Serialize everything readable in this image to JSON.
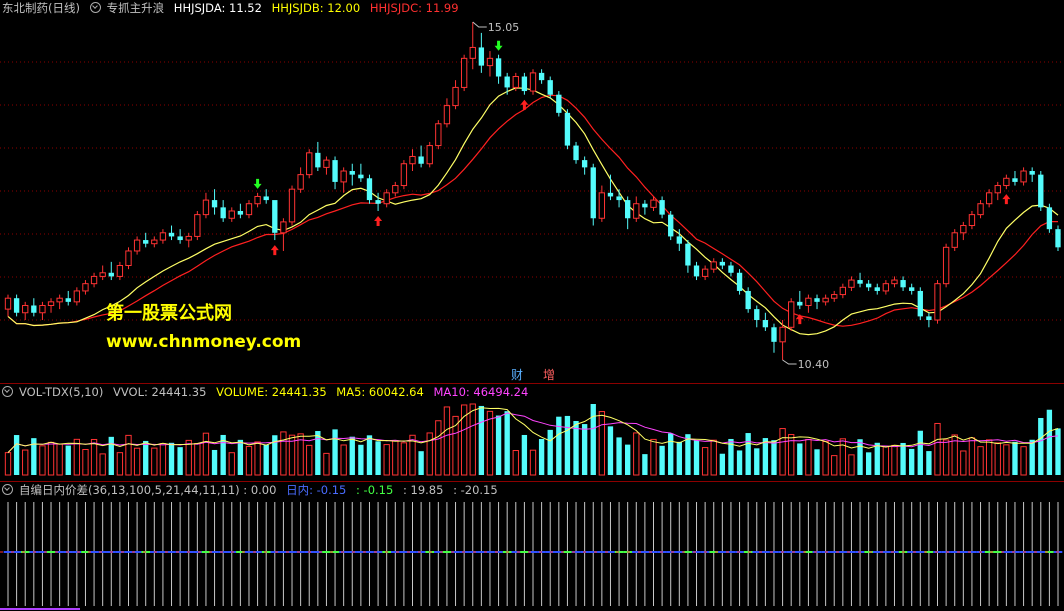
{
  "main_header": {
    "stock": "东北制药(日线)",
    "indicator": "专抓主升浪",
    "a_label": "HHJSJDA: 11.52",
    "b_label": "HHJSJDB: 12.00",
    "c_label": "HHJSJDC: 11.99"
  },
  "price_high_label": "15.05",
  "price_low_label": "10.40",
  "watermark": {
    "line1": "第一股票公式网",
    "line2": "www.chnmoney.com"
  },
  "badges": {
    "cai": "财",
    "zeng": "增"
  },
  "vol_header": {
    "name": "VOL-TDX(5,10)",
    "vvol": "VVOL: 24441.35",
    "volume": "VOLUME: 24441.35",
    "ma5": "MA5: 60042.64",
    "ma10": "MA10: 46494.24"
  },
  "ind_header": {
    "name": "自编日内价差(36,13,100,5,21,44,11,11) : 0.00",
    "rinei": "日内: -0.15",
    "v2": ": -0.15",
    "v3": ": 19.85",
    "v4": ": -20.15"
  },
  "colors": {
    "up": "#ff3333",
    "down": "#54fcfc",
    "ma_fast": "#ffff66",
    "ma_slow": "#ff2020",
    "vol_ma5": "#ffff66",
    "vol_ma10": "#ff44ff",
    "grid": "#8b0000"
  },
  "icons": {
    "up_arrow": "red-up-arrow-icon",
    "down_arrow": "green-down-arrow-icon"
  },
  "chart_data": {
    "type": "candlestick",
    "price_ticks": {
      "high": 15.05,
      "low": 10.4
    },
    "candles": [
      [
        11.1,
        11.3,
        11.0,
        11.25
      ],
      [
        11.25,
        11.3,
        11.0,
        11.05
      ],
      [
        11.05,
        11.2,
        10.95,
        11.15
      ],
      [
        11.15,
        11.25,
        11.0,
        11.05
      ],
      [
        11.05,
        11.2,
        10.95,
        11.15
      ],
      [
        11.15,
        11.25,
        11.05,
        11.2
      ],
      [
        11.2,
        11.3,
        11.1,
        11.25
      ],
      [
        11.25,
        11.35,
        11.15,
        11.2
      ],
      [
        11.2,
        11.4,
        11.15,
        11.35
      ],
      [
        11.35,
        11.5,
        11.3,
        11.45
      ],
      [
        11.45,
        11.6,
        11.4,
        11.55
      ],
      [
        11.55,
        11.7,
        11.5,
        11.6
      ],
      [
        11.6,
        11.75,
        11.5,
        11.55
      ],
      [
        11.55,
        11.75,
        11.5,
        11.7
      ],
      [
        11.7,
        11.95,
        11.65,
        11.9
      ],
      [
        11.9,
        12.1,
        11.85,
        12.05
      ],
      [
        12.05,
        12.15,
        11.95,
        12.0
      ],
      [
        12.0,
        12.1,
        11.95,
        12.05
      ],
      [
        12.05,
        12.2,
        12.0,
        12.15
      ],
      [
        12.15,
        12.25,
        12.05,
        12.1
      ],
      [
        12.1,
        12.2,
        12.0,
        12.05
      ],
      [
        12.05,
        12.15,
        11.95,
        12.1
      ],
      [
        12.1,
        12.45,
        12.05,
        12.4
      ],
      [
        12.4,
        12.7,
        12.35,
        12.6
      ],
      [
        12.6,
        12.75,
        12.4,
        12.5
      ],
      [
        12.5,
        12.6,
        12.3,
        12.35
      ],
      [
        12.35,
        12.5,
        12.3,
        12.45
      ],
      [
        12.45,
        12.55,
        12.35,
        12.4
      ],
      [
        12.4,
        12.6,
        12.35,
        12.55
      ],
      [
        12.55,
        12.7,
        12.5,
        12.65
      ],
      [
        12.65,
        12.75,
        12.55,
        12.6
      ],
      [
        12.6,
        12.5,
        12.05,
        12.15
      ],
      [
        12.15,
        12.35,
        11.9,
        12.3
      ],
      [
        12.3,
        12.8,
        12.25,
        12.75
      ],
      [
        12.75,
        13.05,
        12.7,
        12.95
      ],
      [
        12.95,
        13.3,
        12.9,
        13.25
      ],
      [
        13.25,
        13.4,
        13.0,
        13.05
      ],
      [
        13.05,
        13.2,
        12.95,
        13.15
      ],
      [
        13.15,
        13.2,
        12.75,
        12.85
      ],
      [
        12.85,
        13.05,
        12.7,
        13.0
      ],
      [
        13.0,
        13.1,
        12.8,
        12.95
      ],
      [
        12.95,
        13.1,
        12.85,
        12.9
      ],
      [
        12.9,
        12.95,
        12.55,
        12.6
      ],
      [
        12.6,
        12.7,
        12.45,
        12.55
      ],
      [
        12.55,
        12.75,
        12.5,
        12.7
      ],
      [
        12.7,
        12.85,
        12.65,
        12.8
      ],
      [
        12.8,
        13.15,
        12.75,
        13.1
      ],
      [
        13.1,
        13.3,
        13.0,
        13.2
      ],
      [
        13.2,
        13.35,
        13.05,
        13.1
      ],
      [
        13.1,
        13.4,
        13.05,
        13.35
      ],
      [
        13.35,
        13.7,
        13.3,
        13.65
      ],
      [
        13.65,
        14.0,
        13.6,
        13.9
      ],
      [
        13.9,
        14.25,
        13.85,
        14.15
      ],
      [
        14.15,
        14.6,
        14.1,
        14.55
      ],
      [
        14.55,
        15.05,
        14.4,
        14.7
      ],
      [
        14.7,
        14.9,
        14.35,
        14.45
      ],
      [
        14.45,
        14.65,
        14.3,
        14.55
      ],
      [
        14.55,
        14.6,
        14.2,
        14.3
      ],
      [
        14.3,
        14.35,
        14.05,
        14.15
      ],
      [
        14.15,
        14.35,
        14.1,
        14.3
      ],
      [
        14.3,
        14.35,
        14.05,
        14.1
      ],
      [
        14.1,
        14.4,
        14.05,
        14.35
      ],
      [
        14.35,
        14.4,
        14.2,
        14.25
      ],
      [
        14.25,
        14.3,
        14.0,
        14.05
      ],
      [
        14.05,
        14.1,
        13.75,
        13.8
      ],
      [
        13.8,
        13.85,
        13.3,
        13.35
      ],
      [
        13.35,
        13.4,
        13.1,
        13.15
      ],
      [
        13.15,
        13.2,
        12.95,
        13.05
      ],
      [
        13.05,
        13.1,
        12.25,
        12.35
      ],
      [
        12.35,
        12.8,
        12.3,
        12.7
      ],
      [
        12.7,
        12.95,
        12.6,
        12.65
      ],
      [
        12.65,
        12.75,
        12.5,
        12.6
      ],
      [
        12.6,
        12.65,
        12.2,
        12.35
      ],
      [
        12.35,
        12.65,
        12.3,
        12.55
      ],
      [
        12.55,
        12.6,
        12.4,
        12.5
      ],
      [
        12.5,
        12.65,
        12.45,
        12.6
      ],
      [
        12.6,
        12.65,
        12.35,
        12.4
      ],
      [
        12.4,
        12.45,
        12.05,
        12.1
      ],
      [
        12.1,
        12.2,
        11.9,
        12.0
      ],
      [
        12.0,
        12.05,
        11.6,
        11.7
      ],
      [
        11.7,
        11.75,
        11.5,
        11.55
      ],
      [
        11.55,
        11.7,
        11.5,
        11.65
      ],
      [
        11.65,
        11.8,
        11.6,
        11.75
      ],
      [
        11.75,
        11.8,
        11.65,
        11.7
      ],
      [
        11.7,
        11.75,
        11.55,
        11.6
      ],
      [
        11.6,
        11.65,
        11.3,
        11.35
      ],
      [
        11.35,
        11.4,
        11.05,
        11.1
      ],
      [
        11.1,
        11.15,
        10.85,
        10.95
      ],
      [
        10.95,
        11.05,
        10.8,
        10.85
      ],
      [
        10.85,
        10.9,
        10.5,
        10.65
      ],
      [
        10.65,
        10.95,
        10.4,
        10.85
      ],
      [
        10.85,
        11.25,
        10.8,
        11.2
      ],
      [
        11.2,
        11.35,
        11.1,
        11.15
      ],
      [
        11.15,
        11.3,
        11.05,
        11.25
      ],
      [
        11.25,
        11.3,
        11.1,
        11.2
      ],
      [
        11.2,
        11.3,
        11.15,
        11.25
      ],
      [
        11.25,
        11.35,
        11.2,
        11.3
      ],
      [
        11.3,
        11.45,
        11.25,
        11.4
      ],
      [
        11.4,
        11.55,
        11.35,
        11.5
      ],
      [
        11.5,
        11.6,
        11.4,
        11.45
      ],
      [
        11.45,
        11.5,
        11.35,
        11.4
      ],
      [
        11.4,
        11.45,
        11.3,
        11.35
      ],
      [
        11.35,
        11.5,
        11.3,
        11.45
      ],
      [
        11.45,
        11.55,
        11.4,
        11.5
      ],
      [
        11.5,
        11.55,
        11.35,
        11.4
      ],
      [
        11.4,
        11.45,
        11.3,
        11.35
      ],
      [
        11.35,
        11.4,
        10.95,
        11.0
      ],
      [
        11.0,
        11.05,
        10.85,
        10.95
      ],
      [
        10.95,
        11.5,
        10.9,
        11.45
      ],
      [
        11.45,
        12.0,
        11.4,
        11.95
      ],
      [
        11.95,
        12.2,
        11.9,
        12.15
      ],
      [
        12.15,
        12.3,
        12.05,
        12.25
      ],
      [
        12.25,
        12.45,
        12.2,
        12.4
      ],
      [
        12.4,
        12.6,
        12.35,
        12.55
      ],
      [
        12.55,
        12.75,
        12.5,
        12.7
      ],
      [
        12.7,
        12.85,
        12.6,
        12.8
      ],
      [
        12.8,
        12.95,
        12.75,
        12.9
      ],
      [
        12.9,
        13.0,
        12.8,
        12.85
      ],
      [
        12.85,
        13.05,
        12.8,
        13.0
      ],
      [
        13.0,
        13.05,
        12.85,
        12.95
      ],
      [
        12.95,
        13.0,
        12.45,
        12.5
      ],
      [
        12.5,
        12.55,
        12.15,
        12.2
      ],
      [
        12.2,
        12.25,
        11.9,
        11.95
      ]
    ],
    "volume_series": [
      {
        "name": "VOLUME",
        "value": 24441.35
      },
      {
        "name": "MA5",
        "value": 60042.64
      },
      {
        "name": "MA10",
        "value": 46494.24
      }
    ]
  }
}
